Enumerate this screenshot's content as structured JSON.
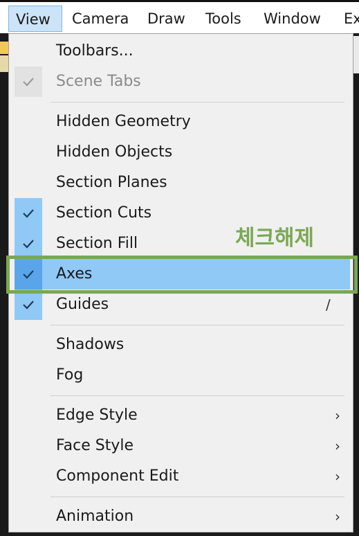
{
  "menubar": {
    "items": [
      "View",
      "Camera",
      "Draw",
      "Tools",
      "Window",
      "Ex"
    ]
  },
  "menu": {
    "toolbars": "Toolbars...",
    "scene_tabs": "Scene Tabs",
    "hidden_geometry": "Hidden Geometry",
    "hidden_objects": "Hidden Objects",
    "section_planes": "Section Planes",
    "section_cuts": "Section Cuts",
    "section_fill": "Section Fill",
    "axes": "Axes",
    "guides": "Guides",
    "guides_shortcut": "/",
    "shadows": "Shadows",
    "fog": "Fog",
    "edge_style": "Edge Style",
    "face_style": "Face Style",
    "component_edit": "Component Edit",
    "animation": "Animation",
    "submenu_arrow": "›"
  },
  "annotation": {
    "text": "체크해제",
    "color": "#7aa852"
  },
  "colors": {
    "check_on_bg": "#90c8f6",
    "highlight_bg": "#90c8f6",
    "active_menu_bg": "#cce4f7"
  },
  "icons": {
    "check": "check-icon",
    "submenu": "chevron-right-icon"
  }
}
